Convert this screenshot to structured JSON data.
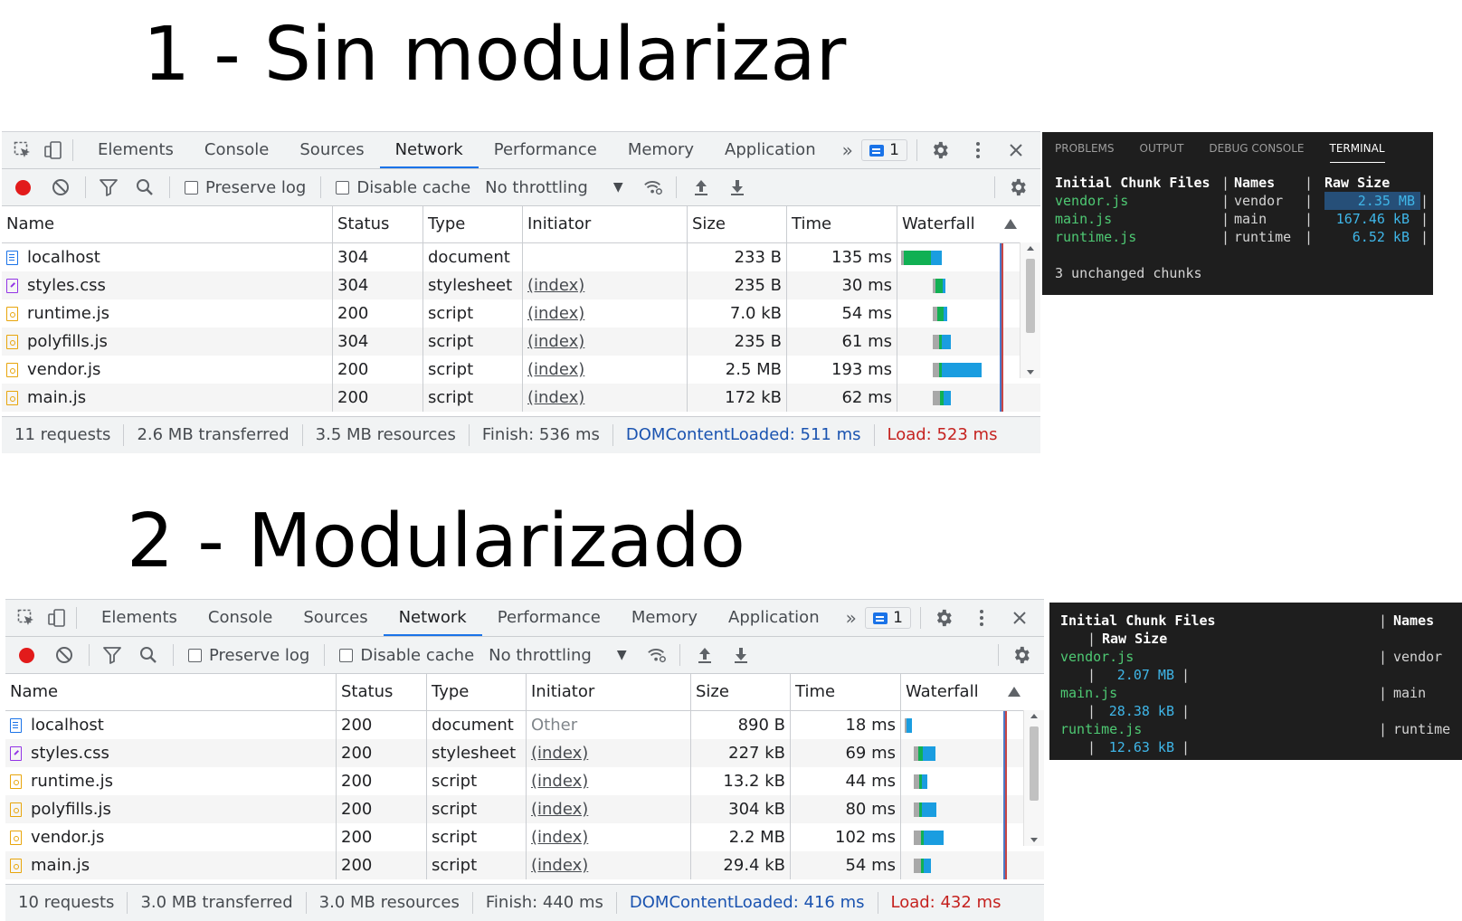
{
  "titles": {
    "first": "1 - Sin modularizar",
    "second": "2 - Modularizado"
  },
  "devtools_common": {
    "tabs": [
      "Elements",
      "Console",
      "Sources",
      "Network",
      "Performance",
      "Memory",
      "Application"
    ],
    "active_tab": "Network",
    "more_tabs": "»",
    "message_count": "1",
    "preserve_log_label": "Preserve log",
    "disable_cache_label": "Disable cache",
    "throttling_value": "No throttling",
    "columns": {
      "name": "Name",
      "status": "Status",
      "type": "Type",
      "initiator": "Initiator",
      "size": "Size",
      "time": "Time",
      "waterfall": "Waterfall"
    },
    "icons": [
      "inspect-element-icon",
      "device-toolbar-icon",
      "record-icon",
      "clear-icon",
      "filter-icon",
      "search-icon",
      "network-conditions-icon",
      "import-har-icon",
      "export-har-icon",
      "gear-icon",
      "kebab-menu-icon",
      "close-icon"
    ]
  },
  "devtools1": {
    "rows": [
      {
        "name": "localhost",
        "icon": "doc",
        "status": "304",
        "type": "document",
        "initiator": "",
        "size": "233 B",
        "time": "135 ms",
        "wf": [
          {
            "c": "gray",
            "w": 3
          },
          {
            "c": "green",
            "w": 30
          },
          {
            "c": "blue",
            "w": 12
          }
        ],
        "wf_start_pct": 3
      },
      {
        "name": "styles.css",
        "icon": "css",
        "status": "304",
        "type": "stylesheet",
        "initiator": "(index)",
        "size": "235 B",
        "time": "30 ms",
        "wf": [
          {
            "c": "gray",
            "w": 3
          },
          {
            "c": "green",
            "w": 8
          },
          {
            "c": "blue",
            "w": 3
          }
        ],
        "wf_start_pct": 28
      },
      {
        "name": "runtime.js",
        "icon": "js",
        "status": "200",
        "type": "script",
        "initiator": "(index)",
        "size": "7.0 kB",
        "time": "54 ms",
        "wf": [
          {
            "c": "gray",
            "w": 5
          },
          {
            "c": "green",
            "w": 7
          },
          {
            "c": "blue",
            "w": 4
          }
        ],
        "wf_start_pct": 28
      },
      {
        "name": "polyfills.js",
        "icon": "js",
        "status": "304",
        "type": "script",
        "initiator": "(index)",
        "size": "235 B",
        "time": "61 ms",
        "wf": [
          {
            "c": "gray",
            "w": 7
          },
          {
            "c": "green",
            "w": 3
          },
          {
            "c": "blue",
            "w": 10
          }
        ],
        "wf_start_pct": 28
      },
      {
        "name": "vendor.js",
        "icon": "js",
        "status": "200",
        "type": "script",
        "initiator": "(index)",
        "size": "2.5 MB",
        "time": "193 ms",
        "wf": [
          {
            "c": "gray",
            "w": 7
          },
          {
            "c": "green",
            "w": 3
          },
          {
            "c": "blue",
            "w": 44
          }
        ],
        "wf_start_pct": 28
      },
      {
        "name": "main.js",
        "icon": "js",
        "status": "200",
        "type": "script",
        "initiator": "(index)",
        "size": "172 kB",
        "time": "62 ms",
        "wf": [
          {
            "c": "gray",
            "w": 8
          },
          {
            "c": "green",
            "w": 4
          },
          {
            "c": "blue",
            "w": 8
          }
        ],
        "wf_start_pct": 28
      }
    ],
    "status_bar": {
      "requests": "11 requests",
      "transferred": "2.6 MB transferred",
      "resources": "3.5 MB resources",
      "finish": "Finish: 536 ms",
      "dcl": "DOMContentLoaded: 511 ms",
      "load": "Load: 523 ms"
    }
  },
  "devtools2": {
    "rows": [
      {
        "name": "localhost",
        "icon": "doc",
        "status": "200",
        "type": "document",
        "initiator": "Other",
        "size": "890 B",
        "time": "18 ms",
        "wf": [
          {
            "c": "gray",
            "w": 2
          },
          {
            "c": "blue",
            "w": 6
          }
        ],
        "wf_start_pct": 3
      },
      {
        "name": "styles.css",
        "icon": "css",
        "status": "200",
        "type": "stylesheet",
        "initiator": "(index)",
        "size": "227 kB",
        "time": "69 ms",
        "wf": [
          {
            "c": "gray",
            "w": 5
          },
          {
            "c": "green",
            "w": 5
          },
          {
            "c": "blue",
            "w": 14
          }
        ],
        "wf_start_pct": 10
      },
      {
        "name": "runtime.js",
        "icon": "js",
        "status": "200",
        "type": "script",
        "initiator": "(index)",
        "size": "13.2 kB",
        "time": "44 ms",
        "wf": [
          {
            "c": "gray",
            "w": 6
          },
          {
            "c": "green",
            "w": 3
          },
          {
            "c": "blue",
            "w": 6
          }
        ],
        "wf_start_pct": 10
      },
      {
        "name": "polyfills.js",
        "icon": "js",
        "status": "200",
        "type": "script",
        "initiator": "(index)",
        "size": "304 kB",
        "time": "80 ms",
        "wf": [
          {
            "c": "gray",
            "w": 6
          },
          {
            "c": "green",
            "w": 3
          },
          {
            "c": "blue",
            "w": 16
          }
        ],
        "wf_start_pct": 10
      },
      {
        "name": "vendor.js",
        "icon": "js",
        "status": "200",
        "type": "script",
        "initiator": "(index)",
        "size": "2.2 MB",
        "time": "102 ms",
        "wf": [
          {
            "c": "gray",
            "w": 8
          },
          {
            "c": "green",
            "w": 3
          },
          {
            "c": "blue",
            "w": 22
          }
        ],
        "wf_start_pct": 10
      },
      {
        "name": "main.js",
        "icon": "js",
        "status": "200",
        "type": "script",
        "initiator": "(index)",
        "size": "29.4 kB",
        "time": "54 ms",
        "wf": [
          {
            "c": "gray",
            "w": 8
          },
          {
            "c": "green",
            "w": 3
          },
          {
            "c": "blue",
            "w": 8
          }
        ],
        "wf_start_pct": 10
      }
    ],
    "status_bar": {
      "requests": "10 requests",
      "transferred": "3.0 MB transferred",
      "resources": "3.0 MB resources",
      "finish": "Finish: 440 ms",
      "dcl": "DOMContentLoaded: 416 ms",
      "load": "Load: 432 ms"
    }
  },
  "terminal1": {
    "tabs": [
      "PROBLEMS",
      "OUTPUT",
      "DEBUG CONSOLE",
      "TERMINAL"
    ],
    "active_tab": "TERMINAL",
    "header": {
      "files": "Initial Chunk Files",
      "names": "Names",
      "raw": "Raw Size"
    },
    "rows": [
      {
        "file": "vendor.js",
        "name": "vendor",
        "size": "2.35 MB"
      },
      {
        "file": "main.js",
        "name": "main",
        "size": "167.46 kB"
      },
      {
        "file": "runtime.js",
        "name": "runtime",
        "size": "6.52 kB"
      }
    ],
    "footer": "3 unchanged chunks"
  },
  "terminal2": {
    "header": {
      "files": "Initial Chunk Files",
      "names": "Names",
      "raw": "Raw Size"
    },
    "rows": [
      {
        "file": "vendor.js",
        "name": "vendor",
        "size": "2.07 MB"
      },
      {
        "file": "main.js",
        "name": "main",
        "size": "28.38 kB"
      },
      {
        "file": "runtime.js",
        "name": "runtime",
        "size": "12.63 kB"
      }
    ]
  },
  "colors": {
    "accent": "#1a73e8",
    "record": "#e21b1b",
    "dcl": "#1a53b0",
    "load": "#c5221f",
    "terminal_bg": "#1e1e1e",
    "terminal_green": "#4ec973",
    "terminal_cyan": "#3fb6e8"
  }
}
